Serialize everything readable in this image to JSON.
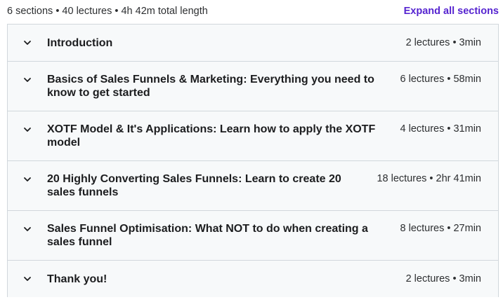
{
  "summary": {
    "text": "6 sections • 40 lectures • 4h 42m total length",
    "expand_all_label": "Expand all sections"
  },
  "sections": [
    {
      "title": "Introduction",
      "meta": "2 lectures • 3min"
    },
    {
      "title": "Basics of Sales Funnels & Marketing: Everything you need to know to get started",
      "meta": "6 lectures • 58min"
    },
    {
      "title": "XOTF Model & It's Applications: Learn how to apply the XOTF model",
      "meta": "4 lectures • 31min"
    },
    {
      "title": "20 Highly Converting Sales Funnels: Learn to create 20 sales funnels",
      "meta": "18 lectures • 2hr 41min"
    },
    {
      "title": "Sales Funnel Optimisation: What NOT to do when creating a sales funnel",
      "meta": "8 lectures • 27min"
    },
    {
      "title": "Thank you!",
      "meta": "2 lectures • 3min"
    }
  ],
  "icons": {
    "chevron": "chevron-down-icon"
  },
  "colors": {
    "accent": "#5624d0",
    "border": "#d1d7dc",
    "section_bg": "#f7f9fa",
    "text": "#1c1d1f"
  }
}
